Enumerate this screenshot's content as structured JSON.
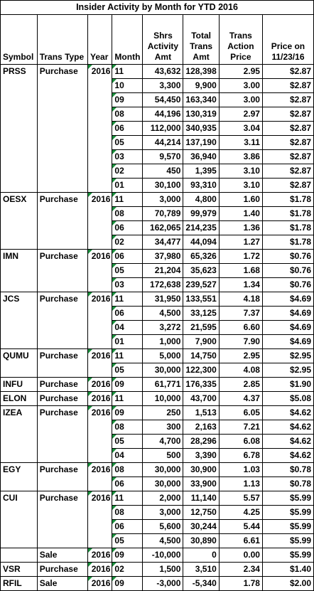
{
  "title": "Insider Activity by Month for YTD 2016",
  "headers": {
    "symbol": "Symbol",
    "trans_type": "Trans Type",
    "year": "Year",
    "month": "Month",
    "shrs": "Shrs Activity Amt",
    "total": "Total Trans Amt",
    "price": "Trans Action Price",
    "price_on": "Price on 11/23/16"
  },
  "rows": [
    {
      "symbol": "PRSS",
      "type": "Purchase",
      "year": "2016",
      "month": "11",
      "shrs": "43,632",
      "total": "128,398",
      "price": "2.95",
      "price_on": "$2.87"
    },
    {
      "symbol": "",
      "type": "",
      "year": "",
      "month": "10",
      "shrs": "3,300",
      "total": "9,900",
      "price": "3.00",
      "price_on": "$2.87"
    },
    {
      "symbol": "",
      "type": "",
      "year": "",
      "month": "09",
      "shrs": "54,450",
      "total": "163,340",
      "price": "3.00",
      "price_on": "$2.87"
    },
    {
      "symbol": "",
      "type": "",
      "year": "",
      "month": "08",
      "shrs": "44,196",
      "total": "130,319",
      "price": "2.97",
      "price_on": "$2.87"
    },
    {
      "symbol": "",
      "type": "",
      "year": "",
      "month": "06",
      "shrs": "112,000",
      "total": "340,935",
      "price": "3.04",
      "price_on": "$2.87"
    },
    {
      "symbol": "",
      "type": "",
      "year": "",
      "month": "05",
      "shrs": "44,214",
      "total": "137,190",
      "price": "3.11",
      "price_on": "$2.87"
    },
    {
      "symbol": "",
      "type": "",
      "year": "",
      "month": "03",
      "shrs": "9,570",
      "total": "36,940",
      "price": "3.86",
      "price_on": "$2.87"
    },
    {
      "symbol": "",
      "type": "",
      "year": "",
      "month": "02",
      "shrs": "450",
      "total": "1,395",
      "price": "3.10",
      "price_on": "$2.87"
    },
    {
      "symbol": "",
      "type": "",
      "year": "",
      "month": "01",
      "shrs": "30,100",
      "total": "93,310",
      "price": "3.10",
      "price_on": "$2.87"
    },
    {
      "symbol": "OESX",
      "type": "Purchase",
      "year": "2016",
      "month": "11",
      "shrs": "3,000",
      "total": "4,800",
      "price": "1.60",
      "price_on": "$1.78"
    },
    {
      "symbol": "",
      "type": "",
      "year": "",
      "month": "08",
      "shrs": "70,789",
      "total": "99,979",
      "price": "1.40",
      "price_on": "$1.78"
    },
    {
      "symbol": "",
      "type": "",
      "year": "",
      "month": "06",
      "shrs": "162,065",
      "total": "214,235",
      "price": "1.36",
      "price_on": "$1.78"
    },
    {
      "symbol": "",
      "type": "",
      "year": "",
      "month": "02",
      "shrs": "34,477",
      "total": "44,094",
      "price": "1.27",
      "price_on": "$1.78"
    },
    {
      "symbol": "IMN",
      "type": "Purchase",
      "year": "2016",
      "month": "06",
      "shrs": "37,980",
      "total": "65,326",
      "price": "1.72",
      "price_on": "$0.76"
    },
    {
      "symbol": "",
      "type": "",
      "year": "",
      "month": "05",
      "shrs": "21,204",
      "total": "35,623",
      "price": "1.68",
      "price_on": "$0.76"
    },
    {
      "symbol": "",
      "type": "",
      "year": "",
      "month": "03",
      "shrs": "172,638",
      "total": "239,527",
      "price": "1.34",
      "price_on": "$0.76"
    },
    {
      "symbol": "JCS",
      "type": "Purchase",
      "year": "2016",
      "month": "11",
      "shrs": "31,950",
      "total": "133,551",
      "price": "4.18",
      "price_on": "$4.69"
    },
    {
      "symbol": "",
      "type": "",
      "year": "",
      "month": "06",
      "shrs": "4,500",
      "total": "33,125",
      "price": "7.37",
      "price_on": "$4.69"
    },
    {
      "symbol": "",
      "type": "",
      "year": "",
      "month": "04",
      "shrs": "3,272",
      "total": "21,595",
      "price": "6.60",
      "price_on": "$4.69"
    },
    {
      "symbol": "",
      "type": "",
      "year": "",
      "month": "01",
      "shrs": "1,000",
      "total": "7,900",
      "price": "7.90",
      "price_on": "$4.69"
    },
    {
      "symbol": "QUMU",
      "type": "Purchase",
      "year": "2016",
      "month": "11",
      "shrs": "5,000",
      "total": "14,750",
      "price": "2.95",
      "price_on": "$2.95"
    },
    {
      "symbol": "",
      "type": "",
      "year": "",
      "month": "05",
      "shrs": "30,000",
      "total": "122,300",
      "price": "4.08",
      "price_on": "$2.95"
    },
    {
      "symbol": "INFU",
      "type": "Purchase",
      "year": "2016",
      "month": "09",
      "shrs": "61,771",
      "total": "176,335",
      "price": "2.85",
      "price_on": "$1.90"
    },
    {
      "symbol": "ELON",
      "type": "Purchase",
      "year": "2016",
      "month": "11",
      "shrs": "10,000",
      "total": "43,700",
      "price": "4.37",
      "price_on": "$5.08"
    },
    {
      "symbol": "IZEA",
      "type": "Purchase",
      "year": "2016",
      "month": "09",
      "shrs": "250",
      "total": "1,513",
      "price": "6.05",
      "price_on": "$4.62"
    },
    {
      "symbol": "",
      "type": "",
      "year": "",
      "month": "08",
      "shrs": "300",
      "total": "2,163",
      "price": "7.21",
      "price_on": "$4.62"
    },
    {
      "symbol": "",
      "type": "",
      "year": "",
      "month": "05",
      "shrs": "4,700",
      "total": "28,296",
      "price": "6.08",
      "price_on": "$4.62"
    },
    {
      "symbol": "",
      "type": "",
      "year": "",
      "month": "04",
      "shrs": "500",
      "total": "3,390",
      "price": "6.78",
      "price_on": "$4.62"
    },
    {
      "symbol": "EGY",
      "type": "Purchase",
      "year": "2016",
      "month": "08",
      "shrs": "30,000",
      "total": "30,900",
      "price": "1.03",
      "price_on": "$0.78"
    },
    {
      "symbol": "",
      "type": "",
      "year": "",
      "month": "06",
      "shrs": "30,000",
      "total": "33,900",
      "price": "1.13",
      "price_on": "$0.78"
    },
    {
      "symbol": "CUI",
      "type": "Purchase",
      "year": "2016",
      "month": "11",
      "shrs": "2,000",
      "total": "11,140",
      "price": "5.57",
      "price_on": "$5.99"
    },
    {
      "symbol": "",
      "type": "",
      "year": "",
      "month": "08",
      "shrs": "3,000",
      "total": "12,750",
      "price": "4.25",
      "price_on": "$5.99"
    },
    {
      "symbol": "",
      "type": "",
      "year": "",
      "month": "06",
      "shrs": "5,600",
      "total": "30,244",
      "price": "5.44",
      "price_on": "$5.99"
    },
    {
      "symbol": "",
      "type": "",
      "year": "",
      "month": "05",
      "shrs": "4,500",
      "total": "30,890",
      "price": "6.61",
      "price_on": "$5.99"
    },
    {
      "symbol": "",
      "type": "Sale",
      "year": "2016",
      "month": "09",
      "shrs": "-10,000",
      "total": "0",
      "price": "0.00",
      "price_on": "$5.99"
    },
    {
      "symbol": "VSR",
      "type": "Purchase",
      "year": "2016",
      "month": "02",
      "shrs": "1,500",
      "total": "3,510",
      "price": "2.34",
      "price_on": "$1.40"
    },
    {
      "symbol": "RFIL",
      "type": "Sale",
      "year": "2016",
      "month": "09",
      "shrs": "-3,000",
      "total": "-5,340",
      "price": "1.78",
      "price_on": "$2.00"
    }
  ]
}
